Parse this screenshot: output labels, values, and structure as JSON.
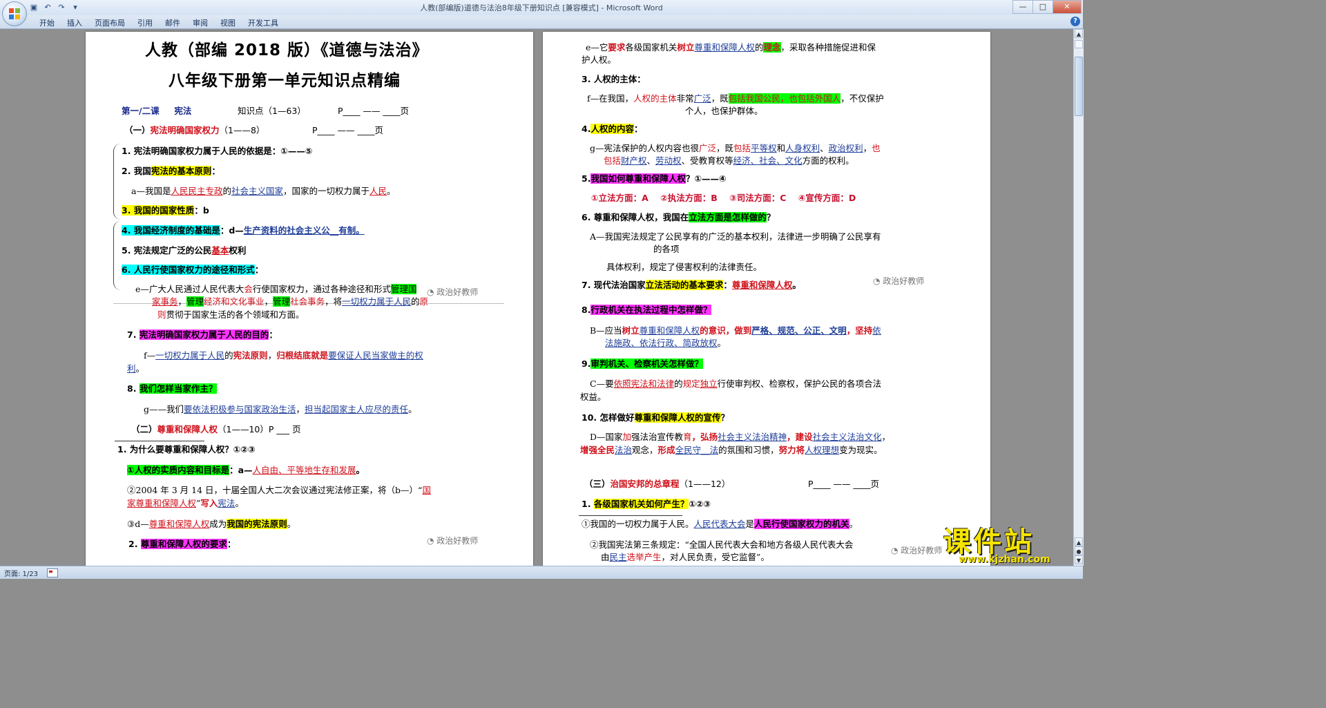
{
  "window": {
    "title": "人教(部编版)道德与法治8年级下册知识点 [兼容模式] - Microsoft Word",
    "controls": {
      "minimize": "—",
      "maximize": "□",
      "close": "✕"
    }
  },
  "quick_access": {
    "save_icon": "save-icon",
    "undo_icon": "undo-icon",
    "redo_icon": "redo-icon",
    "customize": "▾"
  },
  "ribbon": {
    "tabs": [
      "开始",
      "插入",
      "页面布局",
      "引用",
      "邮件",
      "审阅",
      "视图",
      "开发工具"
    ],
    "help": "?"
  },
  "status": {
    "page": "页面: 1/23"
  },
  "brand": {
    "name": "课件站",
    "url": "www.kjzhan.com"
  },
  "watermark": "政治好教师",
  "page1": {
    "title1": "人教（部编 2018 版）《道德与法治》",
    "title2": "八年级下册第一单元知识点精编",
    "lesson": "第一/二课",
    "lesson_topic": "宪法",
    "points": "知识点（1—63）",
    "page_ref": "P____ —— ____页",
    "s1_prefix": "（一）",
    "s1_title": "宪法明确国家权力",
    "s1_range": "（1——8）",
    "s1_page": "P____ —— ____页",
    "q1": "1. 宪法明确国家权力属于人民的依据是：①——⑤",
    "q2_num": "2. 我国",
    "q2_hl": "宪法的基本原则",
    "q2_end": "：",
    "a_prefix": "a—我国是",
    "a_1": "人民民主专政",
    "a_2": "的",
    "a_3": "社会主义国家",
    "a_4": "，国家的一切权力属于",
    "a_5": "人民",
    "a_6": "。",
    "q3_hl": "3. 我国的国家性质",
    "q3_end": "：b",
    "q4_hl": "4. 我国经济制度的基础是",
    "q4_mid": "：d—",
    "q4_end": "生产资料的社会主义公__有制。",
    "q5_a": "5. 宪法规定广泛的公民",
    "q5_b": "基本",
    "q5_c": "权利",
    "q6_hl": "6. 人民行使国家权力的途径和形式",
    "q6_end": "：",
    "e_1": "e—广大人民通过人民代表大",
    "e_2": "会",
    "e_3": "行使国家权力，通过各种途径和",
    "e_4": "形式",
    "e_5": "管理国",
    "e_6": "家事务",
    "e_7": "，",
    "e_8": "管理",
    "e_9": "经济和文化事业",
    "e_10": "，",
    "e_11": "管理",
    "e_12": "社会事务",
    "e_13": "，将",
    "e_14": "一切权力属于人民",
    "e_15": "的",
    "e_16": "原",
    "e_17": "则",
    "e_18": "贯彻于国家生活的各个领域和方面。",
    "q7_num": "7.",
    "q7_hl": "宪法明确国家权力属于人民的目的",
    "q7_end": "：",
    "f_1": "f—",
    "f_2": "一切权力属于人民",
    "f_3": "的",
    "f_4": "宪法原则",
    "f_5": "，",
    "f_6": "归根结底就是",
    "f_7": "要保证人民当家做主的权",
    "f_8": "利",
    "f_9": "。",
    "q8_num": "8.",
    "q8_hl": "我们怎样当家作主？",
    "g_1": "g——我们",
    "g_2": "要依法积极参与国家政治生活",
    "g_3": "，",
    "g_4": "担当起国家主人应尽的责任",
    "g_5": "。",
    "s2_prefix": "（二）",
    "s2_title": "尊重和保障人权",
    "s2_rest": "（1——10）P ___ 页",
    "q21": "1. 为什么要尊重和保障人权？①②③",
    "r1_hl": "①人权的实质内容和目标是",
    "r1_mid": "：a—",
    "r1_end": "人自由、平等地生存和发展",
    "r1_dot": "。",
    "r2_a": "②2004 年 3 月 14 日，十届全国人大二次会议通过宪法修正案，将（b—）“",
    "r2_b": "国",
    "r2_c": "家尊重和保障人权",
    "r2_d": "”",
    "r2_e": "写入",
    "r2_f": "宪法",
    "r2_g": "。",
    "r3_a": "③d—",
    "r3_b": "尊重和保障人权",
    "r3_c": "成为",
    "r3_d": "我国的宪法原则",
    "r3_e": "。",
    "q22_num": "2.",
    "q22_hl": "尊重和保障人权的要求",
    "q22_end": "："
  },
  "page2": {
    "e_1": "e—它",
    "e_2": "要求",
    "e_3": "各级国家机关",
    "e_4": "树立",
    "e_5": "尊重和保障人权",
    "e_6": "的",
    "e_7": "理念",
    "e_8": "，采取各种措施促进和保",
    "e_9": "护人权。",
    "q3": "3. 人权的主体：",
    "f_1": "f—在我国，",
    "f_2": "人权的主体",
    "f_3": "非常",
    "f_4": "广泛",
    "f_5": "，既",
    "f_6": "包括我国公民，",
    "f_7": "也包括外国人",
    "f_8": "，不仅保护",
    "f_9": "个人，也保护群体。",
    "q4_num": "4.",
    "q4_hl": "人权的内容",
    "q4_end": "：",
    "g_1": "g—宪法保护的人权内容也很",
    "g_2": "广泛",
    "g_3": "，既",
    "g_4": "包括",
    "g_5": "平等权",
    "g_6": "和",
    "g_7": "人身权利",
    "g_8": "、",
    "g_9": "政治权利",
    "g_10": "，",
    "g_11": "也",
    "g_12": "包括",
    "g_13": "财产权",
    "g_14": "、",
    "g_15": "劳动权",
    "g_16": "、受教育权等",
    "g_17": "经济、社会、文化",
    "g_18": "方面的权利。",
    "q5_num": "5.",
    "q5_hl": "我国如何尊重和保障人权",
    "q5_end": "？①——④",
    "aspects": "①立法方面：A    ②执法方面：B    ③司法方面：C    ④宣传方面：D",
    "q6_a": "6. 尊重和保障人权，我国在",
    "q6_hl": "立法方面是怎样做的",
    "q6_end": "？",
    "A_1": "A—我国宪法规定了公民享有的广泛的基本权利，法律进一步明确了公民享有",
    "A_2": "的各项",
    "A_3": "具体权利，规定了侵害权利的法律责任。",
    "q7_a": "7. 现代法治国家",
    "q7_hl": "立法活动的基本要求",
    "q7_b": "：",
    "q7_c": "尊重和保障人权",
    "q7_d": "。",
    "q8_num": "8.",
    "q8_hl": "行政机关在执法过程中怎样做？",
    "B_1": "B—应当",
    "B_2": "树立",
    "B_3": "尊重和保障人权",
    "B_4": "的意识",
    "B_5": "，做到",
    "B_6": "严格、规范、公正、文明",
    "B_7": "，坚持",
    "B_8": "依",
    "B_9": "法施政、依法行政、简政放权",
    "B_10": "。",
    "q9_num": "9.",
    "q9_hl": "审判机关、检察机关怎样做？",
    "C_1": "C—要",
    "C_2": "依照宪法和法律",
    "C_3": "的",
    "C_4": "规定",
    "C_5": "独立",
    "C_6": "行使审判权、检察权，保护公民的各项合法",
    "C_7": "权益。",
    "q10_a": "10. 怎样做好",
    "q10_hl": "尊重和保障人权的宣传",
    "q10_end": "？",
    "D_1": "D—国家",
    "D_2": "加",
    "D_3": "强法治宣传教",
    "D_4": "育",
    "D_5": "，弘扬",
    "D_6": "社会主义法治精神",
    "D_7": "，建设",
    "D_8": "社会主义法治文化",
    "D_9": "，",
    "D_10": "增强全民",
    "D_11": "法治",
    "D_12": "观念，",
    "D_13": "形成",
    "D_14": "全民守__法",
    "D_15": "的氛围和习惯，",
    "D_16": "努力将",
    "D_17": "人权理想",
    "D_18": "变为现实。",
    "s3_prefix": "（三）",
    "s3_title": "治国安邦的总章程",
    "s3_range": "（1——12）",
    "s3_page": "P____ —— ____页",
    "q31_num": "1.",
    "q31_hl": "各级国家机关如何产生？",
    "q31_end": "①②③",
    "p1_a": "①我国的一切权力属于人民。",
    "p1_b": "人民代表大会",
    "p1_c": "是",
    "p1_d": "人民行使国家权力的机关",
    "p1_e": "。",
    "p2_a": "②我国宪法",
    "p2_b": "第三条规定：“全国人民代表大会和地方各级人民代表大会",
    "p2_c": "由",
    "p2_d": "民主",
    "p2_e": "选举产生",
    "p2_f": "，对人民负责，受它监督”。"
  }
}
